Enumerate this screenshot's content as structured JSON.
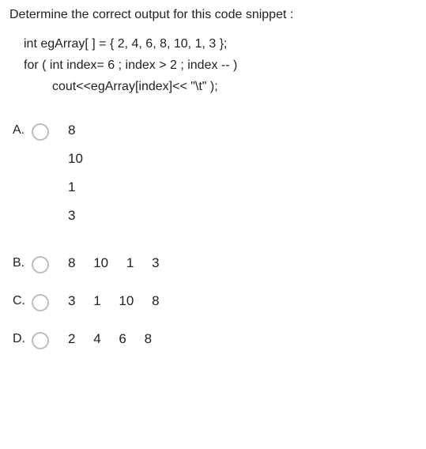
{
  "question": "Determine the correct output for this code snippet :",
  "code": {
    "line1": "int egArray[ ] = { 2, 4, 6, 8, 10, 1, 3 };",
    "line2": "for ( int index= 6 ; index > 2 ; index -- )",
    "line3": "cout<<egArray[index]<< \"\\t\"  );"
  },
  "options": {
    "A": {
      "letter": "A.",
      "v1": "8",
      "v2": "10",
      "v3": "1",
      "v4": "3"
    },
    "B": {
      "letter": "B.",
      "v1": "8",
      "v2": "10",
      "v3": "1",
      "v4": "3"
    },
    "C": {
      "letter": "C.",
      "v1": "3",
      "v2": "1",
      "v3": "10",
      "v4": "8"
    },
    "D": {
      "letter": "D.",
      "v1": "2",
      "v2": "4",
      "v3": "6",
      "v4": "8"
    }
  }
}
